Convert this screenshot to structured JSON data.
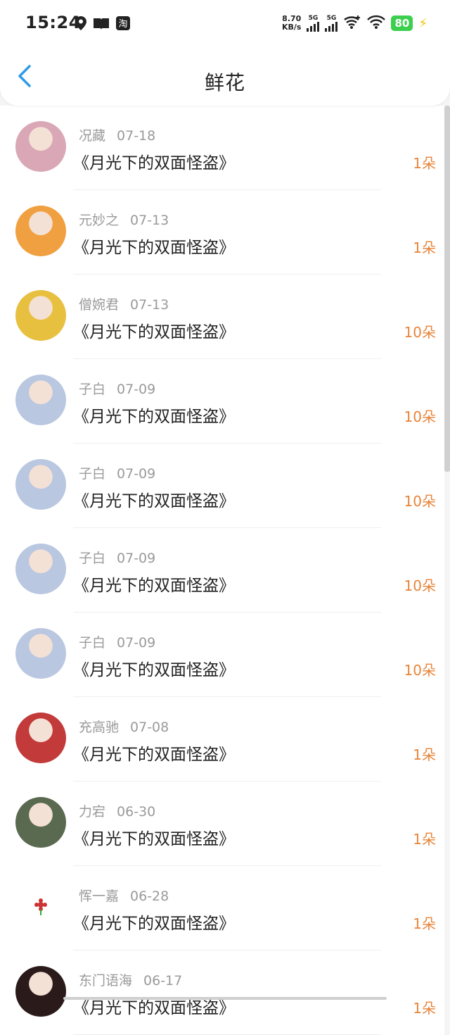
{
  "status_bar": {
    "time": "15:24",
    "net_speed_value": "8.70",
    "net_speed_unit": "KB/s",
    "sim1_label": "5G",
    "sim2_label": "5G",
    "battery": "80",
    "icons_left": [
      "location-icon",
      "book-icon",
      "taobao-icon"
    ],
    "icons_right": [
      "wifi-plus-icon",
      "wifi-icon",
      "charging-icon"
    ]
  },
  "header": {
    "title": "鲜花",
    "back_icon": "chevron-left-icon"
  },
  "colors": {
    "accent_blue": "#2f9be8",
    "count_orange": "#e8843a",
    "meta_gray": "#9a9a9a"
  },
  "records": [
    {
      "name": "况藏",
      "date": "07-18",
      "book": "《月光下的双面怪盗》",
      "count": "1朵",
      "avatar": "#d9a7b5"
    },
    {
      "name": "元妙之",
      "date": "07-13",
      "book": "《月光下的双面怪盗》",
      "count": "1朵",
      "avatar": "#f0a040"
    },
    {
      "name": "僧婉君",
      "date": "07-13",
      "book": "《月光下的双面怪盗》",
      "count": "10朵",
      "avatar": "#e8c040"
    },
    {
      "name": "子白",
      "date": "07-09",
      "book": "《月光下的双面怪盗》",
      "count": "10朵",
      "avatar": "#b9c7e0"
    },
    {
      "name": "子白",
      "date": "07-09",
      "book": "《月光下的双面怪盗》",
      "count": "10朵",
      "avatar": "#b9c7e0"
    },
    {
      "name": "子白",
      "date": "07-09",
      "book": "《月光下的双面怪盗》",
      "count": "10朵",
      "avatar": "#b9c7e0"
    },
    {
      "name": "子白",
      "date": "07-09",
      "book": "《月光下的双面怪盗》",
      "count": "10朵",
      "avatar": "#b9c7e0"
    },
    {
      "name": "充高驰",
      "date": "07-08",
      "book": "《月光下的双面怪盗》",
      "count": "1朵",
      "avatar": "#c23a3a"
    },
    {
      "name": "力宕",
      "date": "06-30",
      "book": "《月光下的双面怪盗》",
      "count": "1朵",
      "avatar": "#5a6a50"
    },
    {
      "name": "恽一嘉",
      "date": "06-28",
      "book": "《月光下的双面怪盗》",
      "count": "1朵",
      "avatar": "#ffffff"
    },
    {
      "name": "东门语海",
      "date": "06-17",
      "book": "《月光下的双面怪盗》",
      "count": "1朵",
      "avatar": "#2a1a1a"
    }
  ]
}
